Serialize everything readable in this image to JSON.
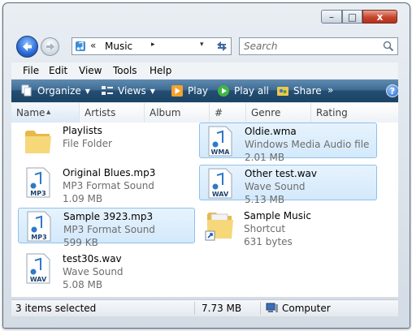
{
  "window": {
    "buttons": {
      "minimize": "–",
      "maximize": "□",
      "close": "x"
    }
  },
  "nav": {
    "address": {
      "separator": "«",
      "location": "Music",
      "arrow": "▸",
      "dropdown": "▾"
    },
    "search": {
      "placeholder": "Search"
    }
  },
  "menu": {
    "items": [
      "File",
      "Edit",
      "View",
      "Tools",
      "Help"
    ]
  },
  "toolbar": {
    "organize": "Organize",
    "views": "Views",
    "play": "Play",
    "play_all": "Play all",
    "share": "Share",
    "more": "»",
    "help": "?"
  },
  "columns": [
    "Name",
    "Artists",
    "Album",
    "#",
    "Genre",
    "Rating"
  ],
  "files": [
    {
      "name": "Playlists",
      "type": "File Folder",
      "size": "",
      "icon": "folder-icon",
      "selected": false
    },
    {
      "name": "Oldie.wma",
      "type": "Windows Media Audio file",
      "size": "2.01 MB",
      "icon": "wma-file-icon",
      "badge": "WMA",
      "selected": true
    },
    {
      "name": "Original Blues.mp3",
      "type": "MP3 Format Sound",
      "size": "1.09 MB",
      "icon": "mp3-file-icon",
      "badge": "MP3",
      "selected": false
    },
    {
      "name": "Other test.wav",
      "type": "Wave Sound",
      "size": "5.13 MB",
      "icon": "wav-file-icon",
      "badge": "WAV",
      "selected": true
    },
    {
      "name": "Sample 3923.mp3",
      "type": "MP3 Format Sound",
      "size": "599 KB",
      "icon": "mp3-file-icon",
      "badge": "MP3",
      "selected": true
    },
    {
      "name": "Sample Music",
      "type": "Shortcut",
      "size": "631 bytes",
      "icon": "shortcut-folder-icon",
      "selected": false
    },
    {
      "name": "test30s.wav",
      "type": "Wave Sound",
      "size": "5.08 MB",
      "icon": "wav-file-icon",
      "badge": "WAV",
      "selected": false
    }
  ],
  "status": {
    "selection": "3 items selected",
    "size": "7.73 MB",
    "location": "Computer"
  },
  "colors": {
    "toolbar": "#2a5478",
    "selection": "#d3e9fb",
    "selection_border": "#8ec1ea"
  }
}
